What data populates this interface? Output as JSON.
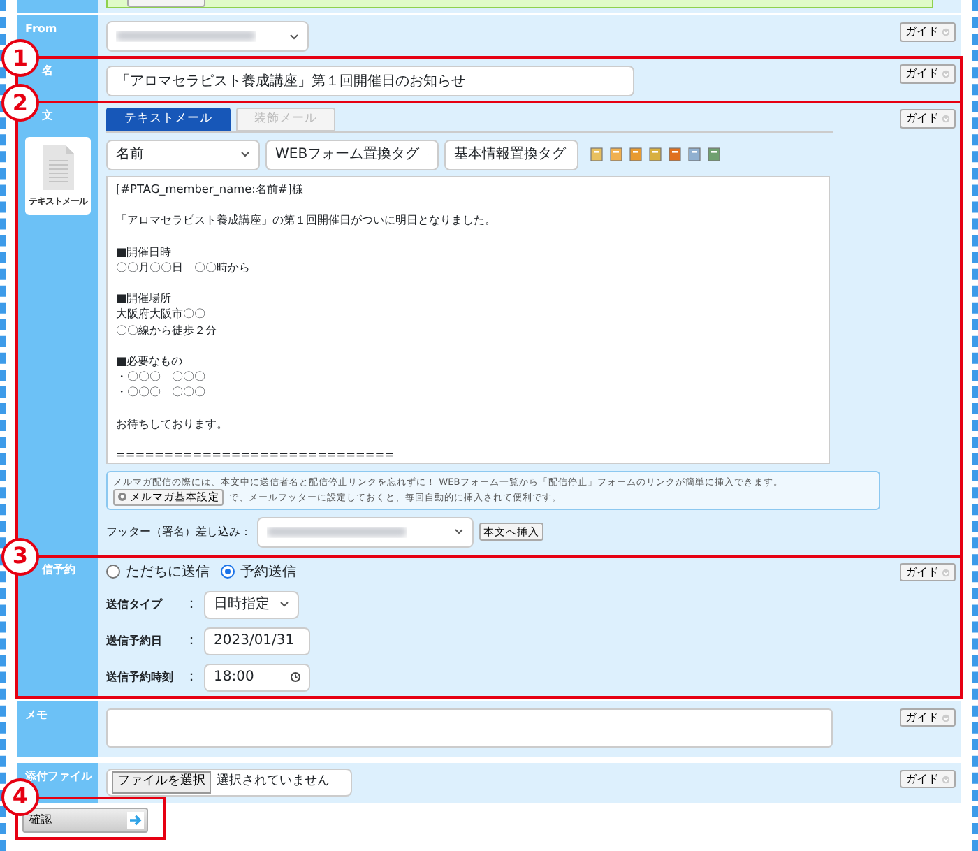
{
  "guide_labels": [
    "ガイド",
    "ガイド",
    "ガイド",
    "ガイド",
    "ガイド",
    "ガイド"
  ],
  "from": {
    "label": "From"
  },
  "subject": {
    "label": "名",
    "value": "「アロマセラピスト養成講座」第１回開催日のお知らせ"
  },
  "body": {
    "label": "文",
    "type_card": "テキストメール",
    "tabs": [
      {
        "label": "テキストメール",
        "selected": true,
        "disabled": false
      },
      {
        "label": "装飾メール",
        "selected": false,
        "disabled": true
      }
    ],
    "tag_selects": [
      "名前",
      "WEBフォーム置換タグ",
      "基本情報置換タグ"
    ],
    "paragraphs": [
      [
        "[#PTAG_member_name:名前#]様"
      ],
      [
        "「アロマセラピスト養成講座」の第１回開催日がついに明日となりました。"
      ],
      [
        "■開催日時",
        "〇〇月〇〇日　〇〇時から"
      ],
      [
        "■開催場所",
        "大阪府大阪市〇〇",
        "〇〇線から徒歩２分"
      ],
      [
        "■必要なもの",
        "・〇〇〇　〇〇〇",
        "・〇〇〇　〇〇〇"
      ],
      [
        "お待ちしております。"
      ],
      [
        "============================="
      ]
    ],
    "notice_line1": "メルマガ配信の際には、本文中に送信者名と配信停止リンクを忘れずに！ WEBフォーム一覧から「配信停止」フォームのリンクが簡単に挿入できます。",
    "notice_button": "メルマガ基本設定",
    "notice_line2": "で、メールフッターに設定しておくと、毎回自動的に挿入されて便利です。",
    "footer_label": "フッター（署名）差し込み：",
    "footer_button": "本文へ挿入"
  },
  "schedule": {
    "label": "信予約",
    "radios": [
      {
        "label": "ただちに送信",
        "selected": false
      },
      {
        "label": "予約送信",
        "selected": true
      }
    ],
    "fields": [
      {
        "kind": "select",
        "label": "送信タイプ",
        "sep": "：",
        "value": "日時指定"
      },
      {
        "kind": "date",
        "label": "送信予約日",
        "sep": "：",
        "value": "2023/01/31"
      },
      {
        "kind": "time",
        "label": "送信予約時刻",
        "sep": "：",
        "value": "18:00"
      }
    ]
  },
  "memo": {
    "label": "メモ"
  },
  "attachment": {
    "label": "添付ファイル",
    "button": "ファイルを選択",
    "status": "選択されていません"
  },
  "confirm_button": "確認",
  "annotations": [
    "1",
    "2",
    "3",
    "4"
  ]
}
